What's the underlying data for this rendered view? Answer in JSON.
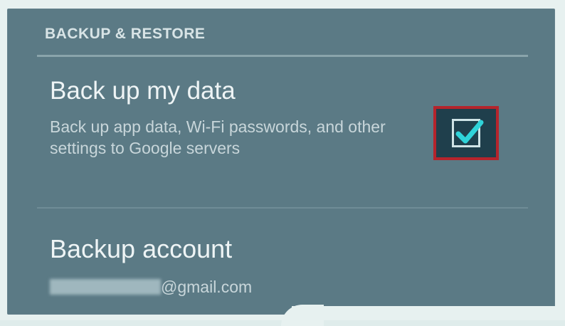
{
  "section": {
    "header": "BACKUP & RESTORE"
  },
  "backup_setting": {
    "title": "Back up my data",
    "summary": "Back up app data, Wi-Fi passwords, and other settings to Google servers",
    "checked": true
  },
  "backup_account": {
    "title": "Backup account",
    "email_visible": "@gmail.com"
  },
  "colors": {
    "panel": "#5b7a85",
    "highlight": "#b5242c",
    "check": "#2fd3d9"
  },
  "icons": {
    "checkbox": "checkbox-checked-icon"
  }
}
